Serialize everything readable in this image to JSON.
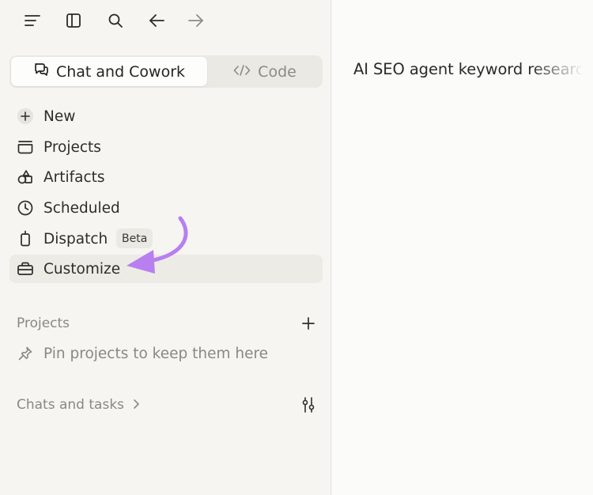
{
  "toolbar": {
    "menu_icon": "menu-icon",
    "sidebar_toggle_icon": "sidebar-toggle-icon",
    "search_icon": "search-icon",
    "back_icon": "arrow-left-icon",
    "forward_icon": "arrow-right-icon"
  },
  "mode_switch": {
    "chat_label": "Chat and Cowork",
    "code_label": "Code"
  },
  "nav": {
    "items": [
      {
        "label": "New",
        "icon": "plus-circle-icon"
      },
      {
        "label": "Projects",
        "icon": "folder-icon"
      },
      {
        "label": "Artifacts",
        "icon": "artifacts-icon"
      },
      {
        "label": "Scheduled",
        "icon": "clock-icon"
      },
      {
        "label": "Dispatch",
        "icon": "device-icon",
        "badge": "Beta"
      },
      {
        "label": "Customize",
        "icon": "briefcase-icon"
      }
    ]
  },
  "projects": {
    "heading": "Projects",
    "empty_hint": "Pin projects to keep them here"
  },
  "chats": {
    "heading": "Chats and tasks"
  },
  "main": {
    "title": "AI SEO agent keyword research"
  },
  "colors": {
    "sidebar_bg": "#f6f5f1",
    "main_bg": "#fbfbfa",
    "annotation_arrow": "#b77ff0"
  }
}
